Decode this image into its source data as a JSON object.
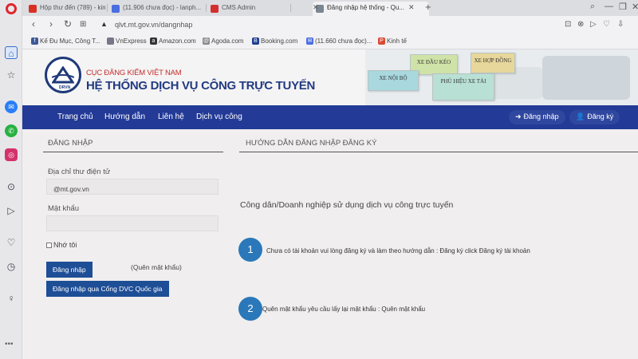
{
  "browser": {
    "tabs": [
      {
        "label": "Hộp thư đến (789) - kimb...",
        "color": "#d93025"
      },
      {
        "label": "(11.906 chưa đọc) - lanph...",
        "color": "#4a6ee0"
      },
      {
        "label": "CMS Admin",
        "color": "#d32f2f"
      },
      {
        "label": "Đăng nhập hệ thống - Qu...",
        "color": "#7a8690",
        "active": true
      }
    ],
    "url": "qlvt.mt.gov.vn/dangnhap",
    "bookmarks": [
      {
        "label": "Kế Đu Mục, Công T...",
        "color": "#3b5998",
        "icon": "facebook-icon"
      },
      {
        "label": "VnExpress",
        "color": "#556",
        "icon": "page-icon"
      },
      {
        "label": "Amazon.com",
        "color": "#333",
        "icon": "amazon-icon"
      },
      {
        "label": "Agoda.com",
        "color": "#555",
        "icon": "agoda-icon"
      },
      {
        "label": "Booking.com",
        "color": "#1d3f8f",
        "icon": "booking-icon"
      },
      {
        "label": "(11.660 chưa đọc)...",
        "color": "#4a6ee0",
        "icon": "mail-icon"
      },
      {
        "label": "Kinh tế",
        "color": "#d94a34",
        "icon": "news-icon"
      }
    ]
  },
  "site": {
    "subtitle": "CỤC ĐĂNG KIỂM VIỆT NAM",
    "title": "HỆ THỐNG DỊCH VỤ CÔNG TRỰC TUYẾN",
    "logo_text": "DRVN",
    "plates": [
      "XE NỘI BỘ",
      "XE ĐẦU KÉO",
      "PHÙ HIỆU XE TẢI",
      "XE HỢP ĐỒNG"
    ]
  },
  "nav": {
    "items": [
      "Trang chủ",
      "Hướng dẫn",
      "Liên hệ",
      "Dịch vụ công"
    ],
    "login": "Đăng nhập",
    "register": "Đăng ký"
  },
  "login": {
    "heading": "ĐĂNG NHẬP",
    "email_label": "Địa chỉ thư điện tử",
    "email_value": "@mt.gov.vn",
    "password_label": "Mật khẩu",
    "remember": "Nhớ tôi",
    "submit": "Đăng nhập",
    "forgot": "(Quên mật khẩu)",
    "national_portal": "Đăng nhập qua Cổng DVC Quốc gia"
  },
  "guide": {
    "heading": "HƯỚNG DẪN ĐĂNG NHẬP ĐĂNG KÝ",
    "intro": "Công dân/Doanh nghiệp sử dụng dịch vụ công trực tuyến",
    "steps": [
      {
        "num": "1",
        "text": "Chưa có tài khoản vui lòng đăng ký và làm theo hướng dẫn : Đăng ký click  Đăng ký tài khoản"
      },
      {
        "num": "2",
        "text": "Quên mật khẩu  yêu cầu lấy lại mật khẩu : Quên mật khẩu"
      }
    ]
  }
}
